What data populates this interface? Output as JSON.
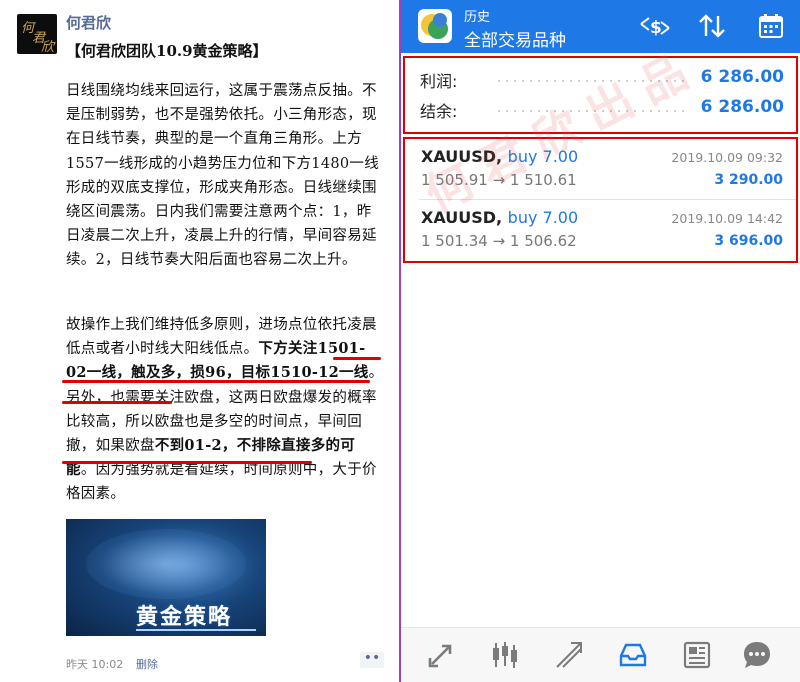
{
  "left": {
    "avatar_text": [
      "何",
      "君",
      "欣"
    ],
    "author": "何君欣",
    "post_title": "【何君欣团队10.9黄金策略】",
    "paragraph1": "日线围绕均线来回运行，这属于震荡点反抽。不是压制弱势，也不是强势依托。小三角形态，现在日线节奏，典型的是一个直角三角形。上方1557一线形成的小趋势压力位和下方1480一线形成的双底支撑位，形成夹角形态。日线继续围绕区间震荡。日内我们需要注意两个点：1，昨日凌晨二次上升，凌晨上升的行情，早间容易延续。2，日线节奏大阳后面也容易二次上升。",
    "paragraph2_a": "故操作上我们维持低多原则，进场点位依托凌晨低点或者小时线大阳线低点。",
    "paragraph2_hl1": "下方关注1501-02一线，触及多，损96，目标1510-12一线",
    "paragraph2_b": "。另外，也需要关注欧盘，这两日欧盘爆发的概率比较高，所以欧盘也是多空的时间点，早间回撤，如果欧盘",
    "paragraph2_hl2": "不到01-2，不排除直接多的可能",
    "paragraph2_c": "。因为强势就是看延续，时间原则中，大于价格因素。",
    "banner_title": "黄金策略",
    "meta_time": "昨天 10:02",
    "delete_label": "删除",
    "more_label": "••"
  },
  "right": {
    "header_small": "历史",
    "header_big": "全部交易品种",
    "summary": [
      {
        "label": "利润:",
        "value": "6 286.00"
      },
      {
        "label": "结余:",
        "value": "6 286.00"
      }
    ],
    "deals": [
      {
        "symbol": "XAUUSD,",
        "side": "buy 7.00",
        "prices": "1 505.91 → 1 510.61",
        "time": "2019.10.09 09:32",
        "profit": "3 290.00"
      },
      {
        "symbol": "XAUUSD,",
        "side": "buy 7.00",
        "prices": "1 501.34 → 1 506.62",
        "time": "2019.10.09 14:42",
        "profit": "3 696.00"
      }
    ],
    "watermark": "何君欣出品",
    "icons": {
      "header": [
        "dollar-swap-icon",
        "sort-icon",
        "calendar-icon"
      ],
      "nav": [
        "quotes-icon",
        "chart-icon",
        "trade-icon",
        "history-icon",
        "news-icon",
        "chat-icon"
      ]
    },
    "colors": {
      "accent": "#1e78e6",
      "highlight_box": "#e00000",
      "divider": "#9b3fc4"
    }
  }
}
